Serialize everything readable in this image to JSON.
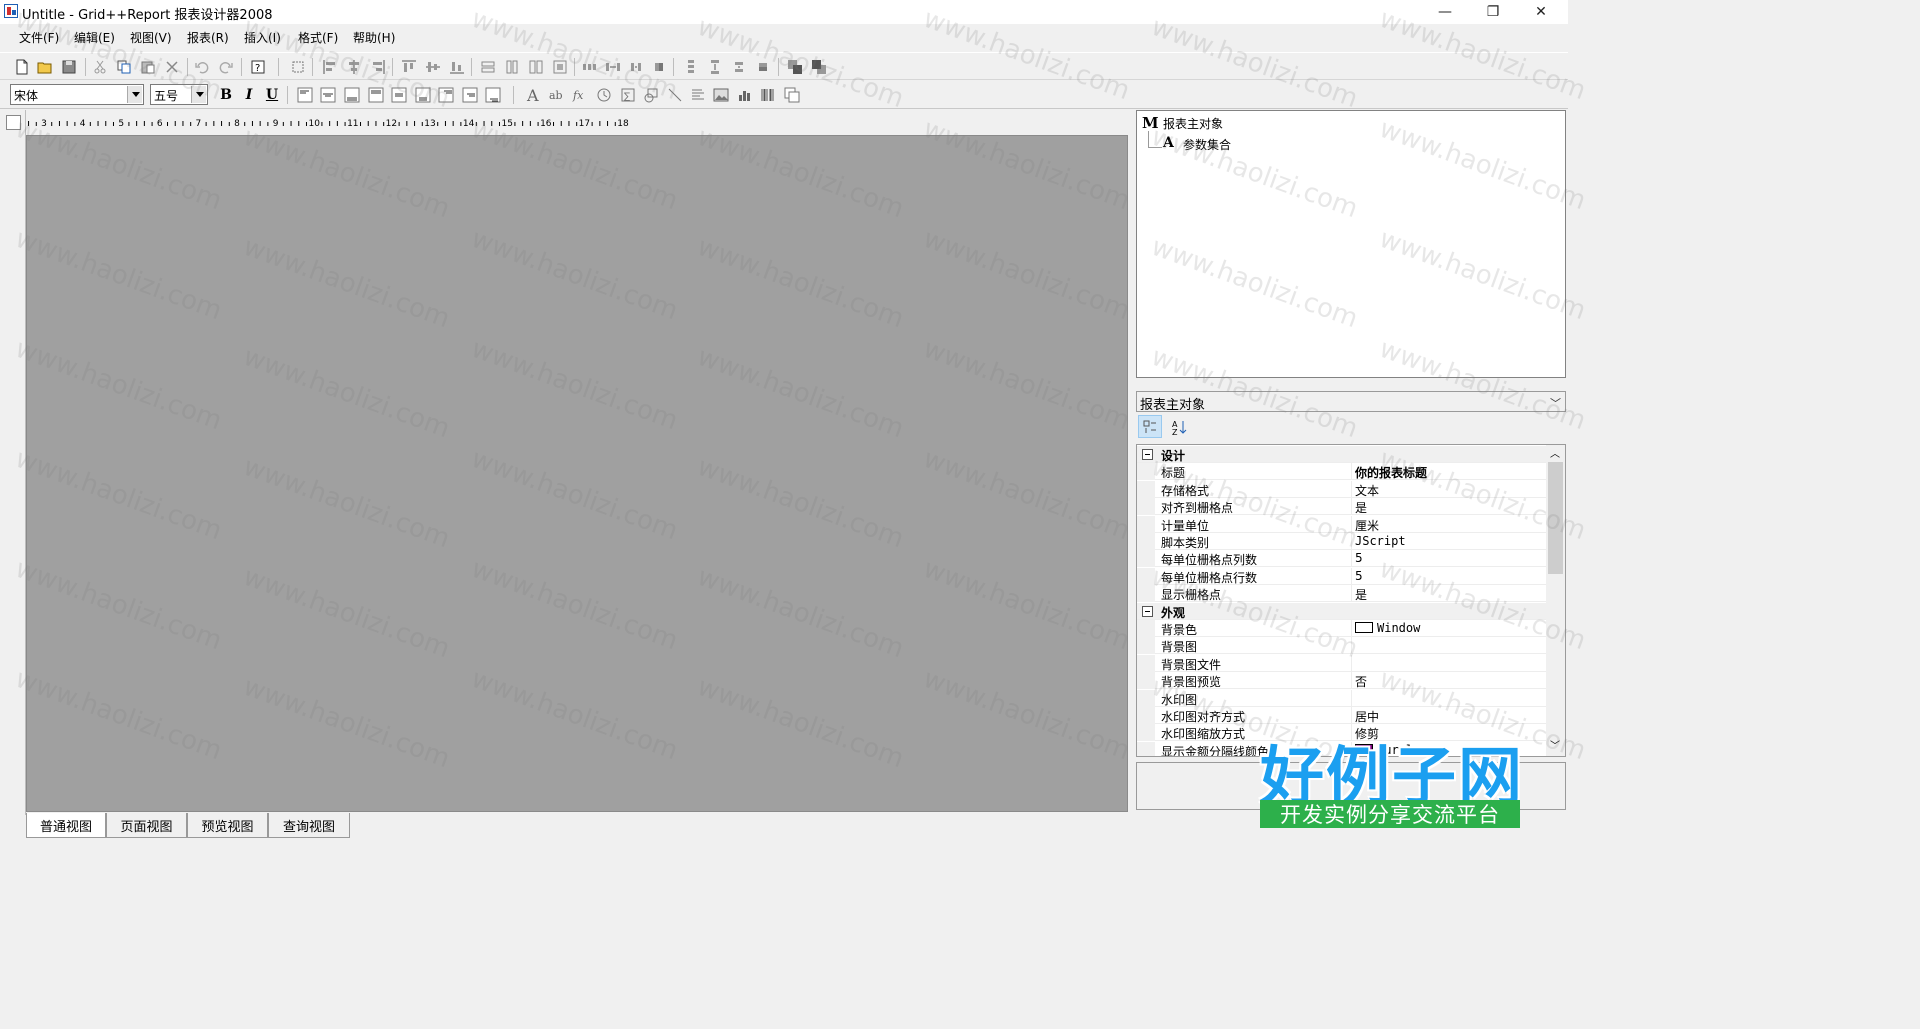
{
  "window": {
    "title": "Untitle - Grid++Report 报表设计器2008",
    "minimize_glyph": "—",
    "restore_glyph": "❐",
    "close_glyph": "✕"
  },
  "menu": [
    "文件(F)",
    "编辑(E)",
    "视图(V)",
    "报表(R)",
    "插入(I)",
    "格式(F)",
    "帮助(H)"
  ],
  "toolbar2": {
    "font_name": "宋体",
    "font_size": "五号",
    "bold": "B",
    "italic": "I",
    "underline": "U"
  },
  "ruler": {
    "numbers": [
      "3",
      "4",
      "5",
      "6",
      "7",
      "8",
      "9",
      "10",
      "11",
      "12",
      "13",
      "14",
      "15",
      "16",
      "17",
      "18"
    ]
  },
  "tabs": [
    "普通视图",
    "页面视图",
    "预览视图",
    "查询视图"
  ],
  "tree": {
    "root_icon": "M",
    "root_label": "报表主对象",
    "child_icon": "A",
    "child_label": "参数集合"
  },
  "property_panel": {
    "object_selector": "报表主对象",
    "categorized_icon": "categorized-icon",
    "sort_icon": "alphabetical-sort-icon",
    "categories": [
      {
        "name": "设计",
        "rows": [
          {
            "name": "标题",
            "value": "你的报表标题",
            "bold": true
          },
          {
            "name": "存储格式",
            "value": "文本"
          },
          {
            "name": "对齐到栅格点",
            "value": "是"
          },
          {
            "name": "计量单位",
            "value": "厘米"
          },
          {
            "name": "脚本类别",
            "value": "JScript",
            "mono": true
          },
          {
            "name": "每单位栅格点列数",
            "value": "5"
          },
          {
            "name": "每单位栅格点行数",
            "value": "5"
          },
          {
            "name": "显示栅格点",
            "value": "是"
          }
        ]
      },
      {
        "name": "外观",
        "rows": [
          {
            "name": "背景色",
            "value": "Window",
            "mono": true,
            "swatch": "#ffffff"
          },
          {
            "name": "背景图",
            "value": ""
          },
          {
            "name": "背景图文件",
            "value": ""
          },
          {
            "name": "背景图预览",
            "value": "否"
          },
          {
            "name": "水印图",
            "value": ""
          },
          {
            "name": "水印图对齐方式",
            "value": "居中"
          },
          {
            "name": "水印图缩放方式",
            "value": "修剪"
          },
          {
            "name": "显示金额分隔线颜色",
            "value": "Purple",
            "mono": true,
            "swatch": "#800080"
          }
        ]
      }
    ]
  },
  "watermark": {
    "text": "www.haolizi.com",
    "logo_main": "好例子网",
    "logo_sub": "开发实例分享交流平台"
  },
  "colors": {
    "design_surface": "#a0a0a0",
    "logo_blue": "#1b9ff0",
    "logo_green": "#2db04b"
  }
}
